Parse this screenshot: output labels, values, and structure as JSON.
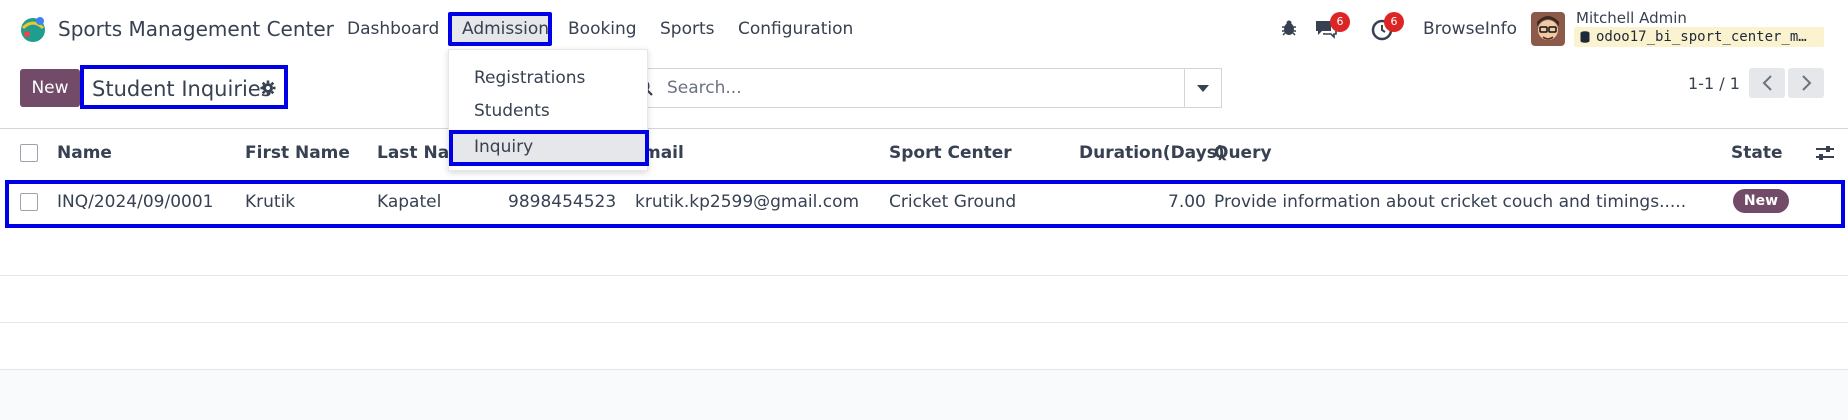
{
  "app": {
    "name": "Sports Management Center"
  },
  "menu": {
    "dashboard": "Dashboard",
    "admission": "Admission",
    "booking": "Booking",
    "sports": "Sports",
    "configuration": "Configuration"
  },
  "systray": {
    "messages_count": "6",
    "activities_count": "6",
    "company": "BrowseInfo",
    "user_name": "Mitchell Admin",
    "database": "odoo17_bi_sport_center_m…"
  },
  "control": {
    "new_label": "New",
    "title": "Student Inquiries",
    "search_placeholder": "Search...",
    "pager": "1-1 / 1"
  },
  "dropdown": {
    "items": [
      "Registrations",
      "Students",
      "Inquiry"
    ],
    "selected": "Inquiry"
  },
  "table": {
    "headers": {
      "name": "Name",
      "first_name": "First Name",
      "last_name": "Last Nam",
      "email": "mail",
      "sport_center": "Sport Center",
      "duration": "Duration(Days)",
      "query": "Query",
      "state": "State"
    },
    "rows": [
      {
        "name": "INQ/2024/09/0001",
        "first_name": "Krutik",
        "last_name": "Kapatel",
        "phone": "9898454523",
        "email": "krutik.kp2599@gmail.com",
        "sport_center": "Cricket Ground",
        "duration": "7.00",
        "query": "Provide information about cricket couch and timings.....",
        "state": "New"
      }
    ]
  },
  "colors": {
    "accent": "#714b67",
    "highlight": "#0000e6",
    "badge": "#dc2626"
  }
}
